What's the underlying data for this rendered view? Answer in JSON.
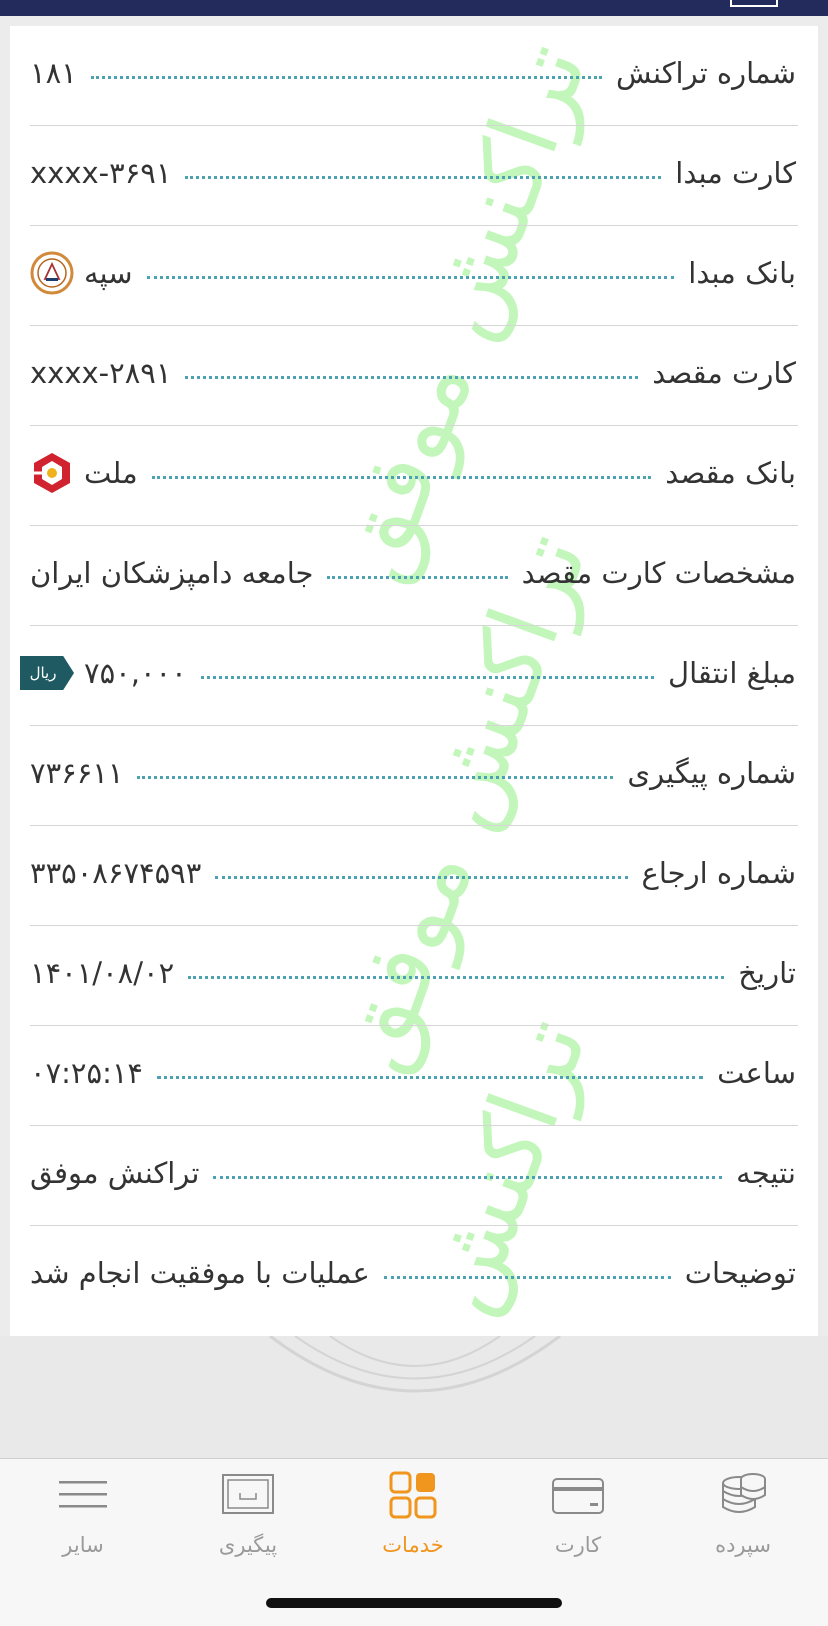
{
  "watermark": "تراکنش موفق",
  "rows": [
    {
      "label": "شماره تراکنش",
      "value": "۱۸۱"
    },
    {
      "label": "کارت مبدا",
      "value": "xxxx-۳۶۹۱"
    },
    {
      "label": "بانک مبدا",
      "value": "سپه"
    },
    {
      "label": "کارت مقصد",
      "value": "xxxx-۲۸۹۱"
    },
    {
      "label": "بانک مقصد",
      "value": "ملت"
    },
    {
      "label": "مشخصات کارت مقصد",
      "value": "جامعه دامپزشکان ایران"
    },
    {
      "label": "مبلغ انتقال",
      "value": "۷۵۰,۰۰۰",
      "unit": "ریال"
    },
    {
      "label": "شماره پیگیری",
      "value": "۷۳۶۶۱۱"
    },
    {
      "label": "شماره ارجاع",
      "value": "۳۳۵۰۸۶۷۴۵۹۳"
    },
    {
      "label": "تاریخ",
      "value": "۱۴۰۱/۰۸/۰۲"
    },
    {
      "label": "ساعت",
      "value": "۰۷:۲۵:۱۴"
    },
    {
      "label": "نتیجه",
      "value": "تراکنش موفق"
    },
    {
      "label": "توضیحات",
      "value": "عملیات با موفقیت انجام شد"
    }
  ],
  "tabs": {
    "other": "سایر",
    "track": "پیگیری",
    "services": "خدمات",
    "card": "کارت",
    "deposit": "سپرده"
  },
  "colors": {
    "top_bar": "#232a5c",
    "dots": "#4ea1b1",
    "active_tab": "#f0951e",
    "badge": "#1f5a63",
    "watermark": "#b9f5b0"
  }
}
